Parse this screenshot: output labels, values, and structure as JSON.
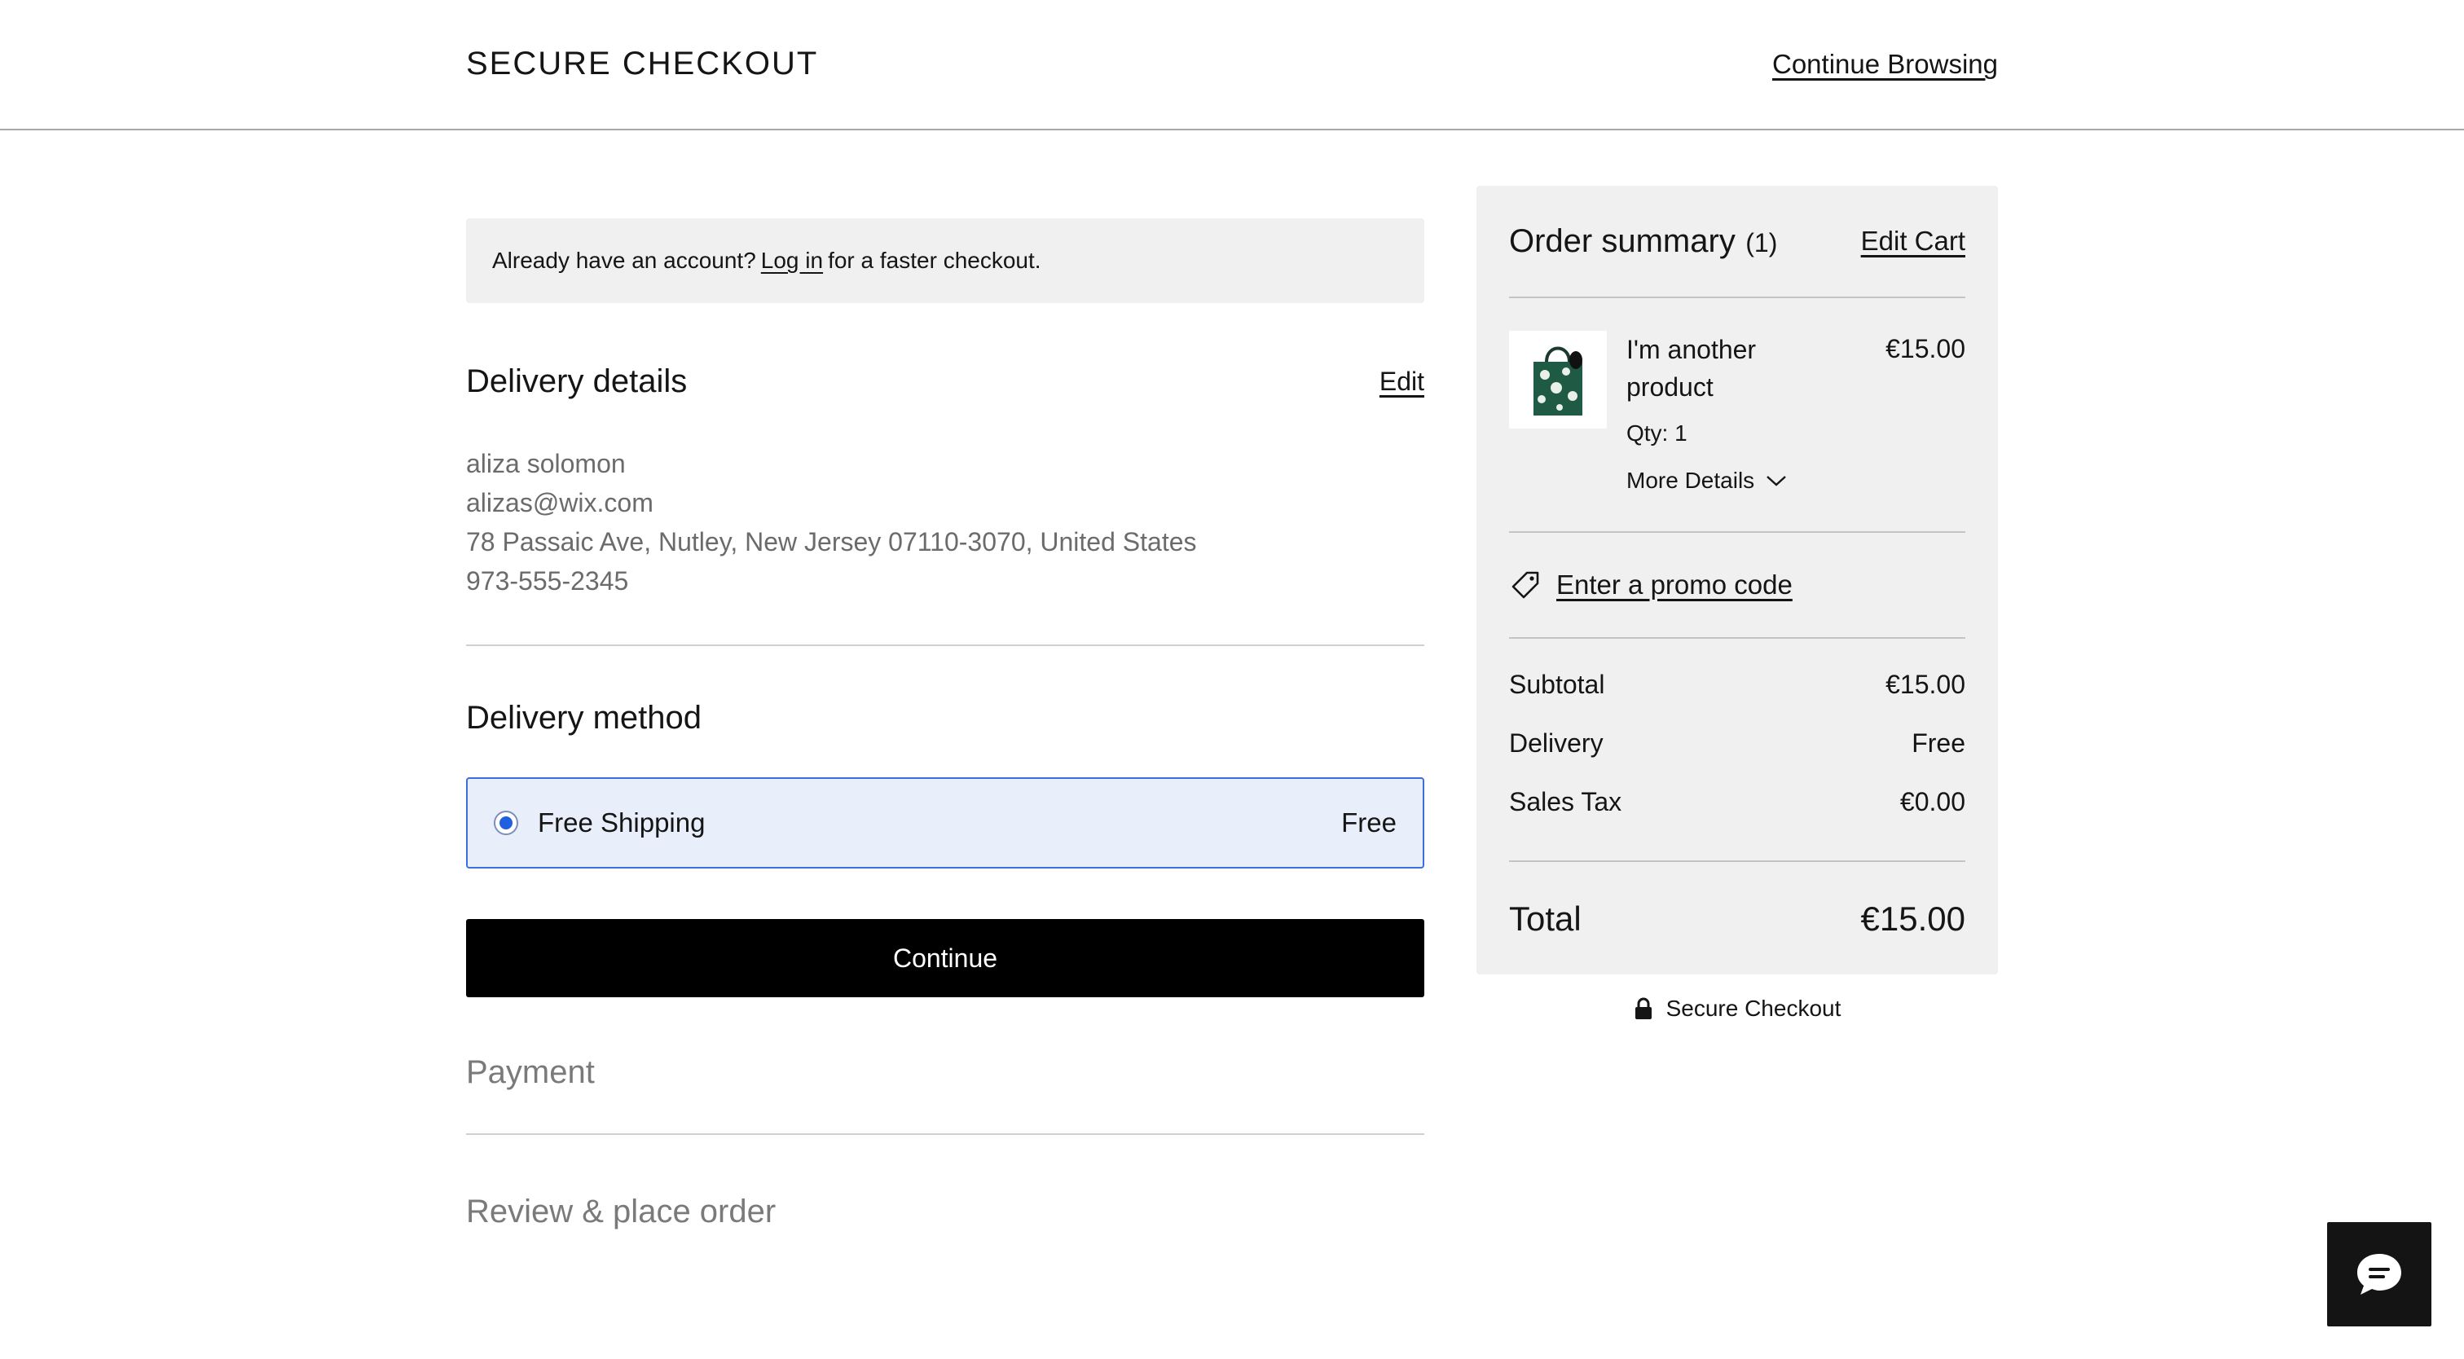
{
  "header": {
    "title": "SECURE CHECKOUT",
    "continue_browsing": "Continue Browsing"
  },
  "login_banner": {
    "prefix": "Already have an account?",
    "link": "Log in",
    "suffix": "for a faster checkout."
  },
  "delivery_details": {
    "title": "Delivery details",
    "edit_label": "Edit",
    "name": "aliza solomon",
    "email": "alizas@wix.com",
    "address": "78 Passaic Ave, Nutley, New Jersey 07110-3070, United States",
    "phone": "973-555-2345"
  },
  "delivery_method": {
    "title": "Delivery method",
    "option_label": "Free Shipping",
    "option_price": "Free",
    "selected": true
  },
  "continue_button": "Continue",
  "payment_title": "Payment",
  "review_title": "Review & place order",
  "order_summary": {
    "title": "Order summary",
    "count": "(1)",
    "edit_cart": "Edit Cart",
    "item": {
      "name": "I'm another product",
      "price": "€15.00",
      "qty": "Qty: 1",
      "more_details": "More Details",
      "thumbnail_icon": "tote-bag-icon"
    },
    "promo_label": "Enter a promo code",
    "rows": [
      {
        "label": "Subtotal",
        "value": "€15.00"
      },
      {
        "label": "Delivery",
        "value": "Free"
      },
      {
        "label": "Sales Tax",
        "value": "€0.00"
      }
    ],
    "total_label": "Total",
    "total_value": "€15.00"
  },
  "secure_footer": "Secure Checkout",
  "colors": {
    "accent": "#1f5fe0",
    "selected_bg": "#e9eefb",
    "button_bg": "#000000",
    "summary_bg": "#f0f0f0"
  }
}
